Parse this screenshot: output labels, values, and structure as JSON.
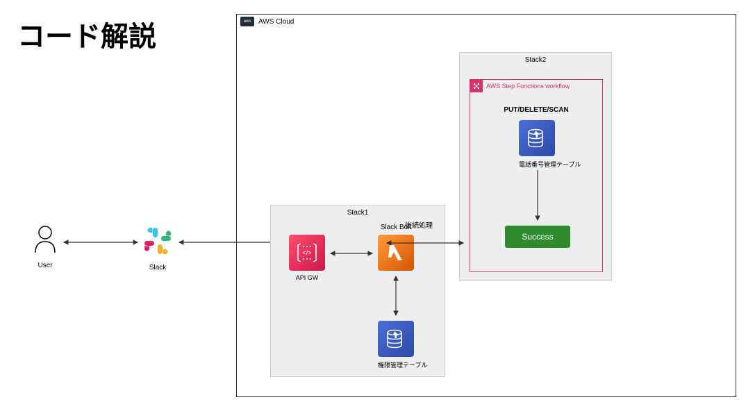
{
  "title": "コード解説",
  "user": {
    "label": "User"
  },
  "slack": {
    "label": "Slack"
  },
  "aws": {
    "label": "AWS Cloud",
    "logo": "aws"
  },
  "stack1": {
    "label": "Stack1",
    "api_gw": {
      "label": "API GW"
    },
    "lambda": {
      "title": "Slack Bolt"
    },
    "dynamo": {
      "label": "権限管理テーブル"
    }
  },
  "stack2": {
    "label": "Stack2",
    "stepfn": {
      "title": "AWS Step Functions workflow",
      "operation": "PUT/DELETE/SCAN",
      "dynamo": {
        "label": "電話番号管理テーブル"
      },
      "success": "Success"
    }
  },
  "arrows": {
    "post_label": "後続処理"
  }
}
